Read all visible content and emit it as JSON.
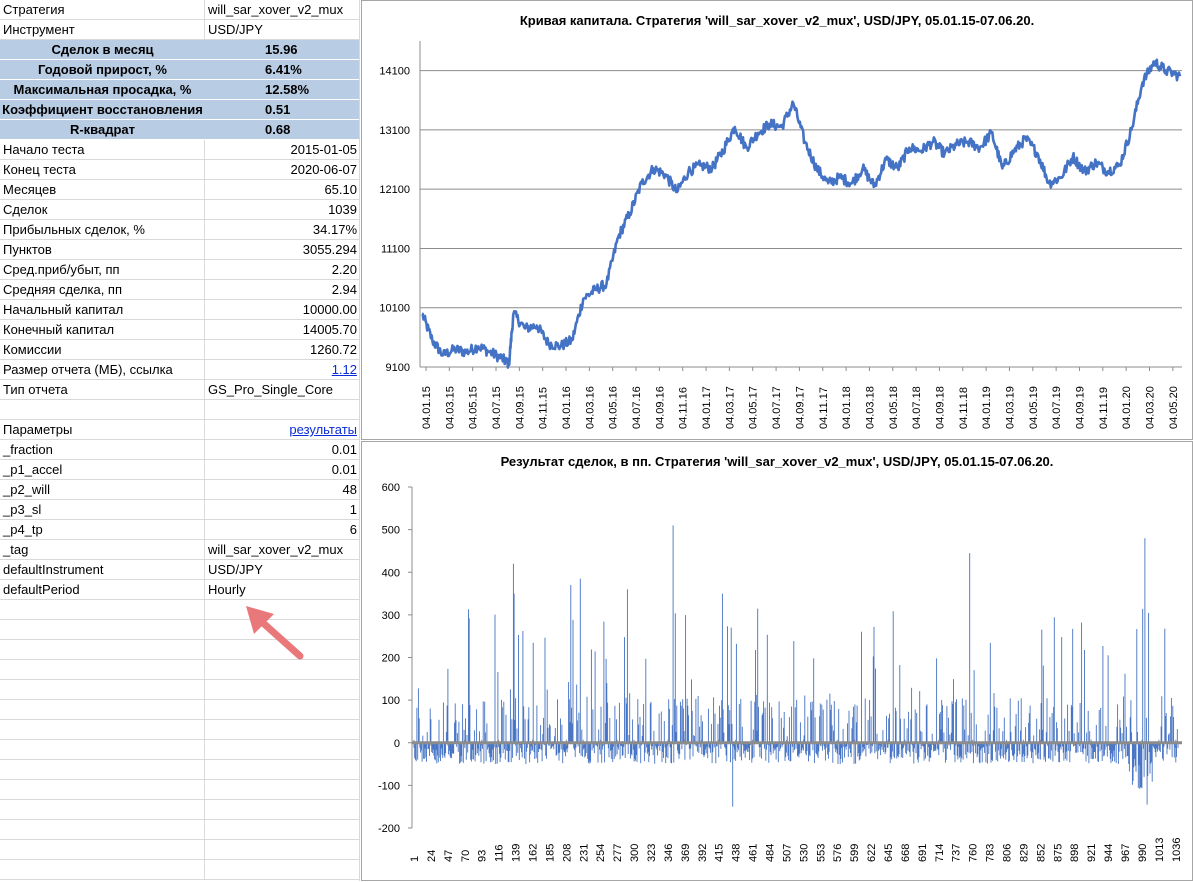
{
  "sheet": {
    "rows": [
      {
        "label": "Стратегия",
        "value": "will_sar_xover_v2_mux",
        "align": "left"
      },
      {
        "label": "Инструмент",
        "value": "USD/JPY",
        "align": "left"
      },
      {
        "label": "Сделок в месяц",
        "value": "15.96",
        "hl": true
      },
      {
        "label": "Годовой прирост, %",
        "value": "6.41%",
        "hl": true
      },
      {
        "label": "Максимальная просадка, %",
        "value": "12.58%",
        "hl": true
      },
      {
        "label": "Коэффициент восстановления",
        "value": "0.51",
        "hl": true
      },
      {
        "label": "R-квадрат",
        "value": "0.68",
        "hl": true
      },
      {
        "label": "Начало теста",
        "value": "2015-01-05"
      },
      {
        "label": "Конец теста",
        "value": "2020-06-07"
      },
      {
        "label": "Месяцев",
        "value": "65.10"
      },
      {
        "label": "Сделок",
        "value": "1039"
      },
      {
        "label": "Прибыльных сделок, %",
        "value": "34.17%"
      },
      {
        "label": "Пунктов",
        "value": "3055.294"
      },
      {
        "label": "Сред.приб/убыт, пп",
        "value": "2.20"
      },
      {
        "label": "Средняя сделка, пп",
        "value": "2.94"
      },
      {
        "label": "Начальный капитал",
        "value": "10000.00"
      },
      {
        "label": "Конечный капитал",
        "value": "14005.70"
      },
      {
        "label": "Комиссии",
        "value": "1260.72"
      },
      {
        "label": "Размер отчета (МБ), ссылка",
        "value": "1.12",
        "link": true
      },
      {
        "label": "Тип отчета",
        "value": "GS_Pro_Single_Core",
        "align": "left"
      },
      {
        "label": "",
        "value": ""
      },
      {
        "label": "Параметры",
        "value": "результаты",
        "link": true
      },
      {
        "label": "_fraction",
        "value": "0.01"
      },
      {
        "label": "_p1_accel",
        "value": "0.01"
      },
      {
        "label": "_p2_will",
        "value": "48"
      },
      {
        "label": "_p3_sl",
        "value": "1"
      },
      {
        "label": "_p4_tp",
        "value": "6"
      },
      {
        "label": "_tag",
        "value": "will_sar_xover_v2_mux",
        "align": "left"
      },
      {
        "label": "defaultInstrument",
        "value": "USD/JPY",
        "align": "left"
      },
      {
        "label": "defaultPeriod",
        "value": "Hourly",
        "align": "left"
      }
    ],
    "empty_rows": 14
  },
  "annotation": {
    "arrow_color": "#e8787a"
  },
  "chart_data": [
    {
      "type": "line",
      "title": "Кривая капитала. Стратегия 'will_sar_xover_v2_mux', USD/JPY, 05.01.15-07.06.20.",
      "xlabel": "",
      "ylabel": "",
      "ylim": [
        9100,
        14600
      ],
      "yticks": [
        9100,
        10100,
        11100,
        12100,
        13100,
        14100
      ],
      "x_tick_labels": [
        "04.01.15",
        "04.03.15",
        "04.05.15",
        "04.07.15",
        "04.09.15",
        "04.11.15",
        "04.01.16",
        "04.03.16",
        "04.05.16",
        "04.07.16",
        "04.09.16",
        "04.11.16",
        "04.01.17",
        "04.03.17",
        "04.05.17",
        "04.07.17",
        "04.09.17",
        "04.11.17",
        "04.01.18",
        "04.03.18",
        "04.05.18",
        "04.07.18",
        "04.09.18",
        "04.11.18",
        "04.01.19",
        "04.03.19",
        "04.05.19",
        "04.07.19",
        "04.09.19",
        "04.11.19",
        "04.01.20",
        "04.03.20",
        "04.05.20"
      ],
      "line_color": "#4472c4",
      "series": [
        {
          "x": [
            "2015-01-05",
            "2015-02-01",
            "2015-03-01",
            "2015-04-01",
            "2015-05-01",
            "2015-06-01",
            "2015-07-01",
            "2015-08-01",
            "2015-08-20",
            "2015-09-01",
            "2015-10-01",
            "2015-11-01",
            "2015-12-01",
            "2016-01-01",
            "2016-02-01",
            "2016-03-01",
            "2016-04-01",
            "2016-05-01",
            "2016-06-01",
            "2016-07-01",
            "2016-08-01",
            "2016-09-01",
            "2016-10-01",
            "2016-11-01",
            "2016-12-01",
            "2017-01-01",
            "2017-02-01",
            "2017-03-01",
            "2017-04-01",
            "2017-05-01",
            "2017-06-01",
            "2017-07-01",
            "2017-08-01",
            "2017-09-01",
            "2017-10-01",
            "2017-11-01",
            "2017-12-01",
            "2018-01-01",
            "2018-02-01",
            "2018-03-01",
            "2018-04-01",
            "2018-05-01",
            "2018-06-01",
            "2018-07-01",
            "2018-08-01",
            "2018-09-01",
            "2018-10-01",
            "2018-11-01",
            "2018-12-01",
            "2019-01-01",
            "2019-02-01",
            "2019-03-01",
            "2019-04-01",
            "2019-05-01",
            "2019-06-01",
            "2019-07-01",
            "2019-08-01",
            "2019-09-01",
            "2019-10-01",
            "2019-11-01",
            "2019-12-01",
            "2020-01-01",
            "2020-02-01",
            "2020-03-01",
            "2020-04-01",
            "2020-05-01",
            "2020-06-07"
          ],
          "y": [
            10000,
            9550,
            9300,
            9400,
            9350,
            9450,
            9350,
            9250,
            9150,
            10000,
            9750,
            9800,
            9500,
            9450,
            9550,
            10250,
            10400,
            10500,
            11300,
            11700,
            12200,
            12450,
            12350,
            12050,
            12400,
            12500,
            12450,
            12750,
            13150,
            12800,
            13050,
            13200,
            13150,
            13550,
            12900,
            12450,
            12200,
            12300,
            12200,
            12450,
            12150,
            12600,
            12450,
            12800,
            12750,
            12900,
            12700,
            12850,
            12900,
            12800,
            13050,
            12450,
            12750,
            12950,
            12700,
            12200,
            12300,
            12650,
            12400,
            12550,
            12400,
            12500,
            13100,
            13900,
            14250,
            14100,
            14005.7
          ]
        }
      ]
    },
    {
      "type": "bar",
      "title": "Результат сделок, в пп. Стратегия 'will_sar_xover_v2_mux', USD/JPY, 05.01.15-07.06.20.",
      "xlabel": "",
      "ylabel": "",
      "ylim": [
        -200,
        600
      ],
      "yticks": [
        -200,
        -100,
        0,
        100,
        200,
        300,
        400,
        500,
        600
      ],
      "x_tick_labels": [
        "1",
        "24",
        "47",
        "70",
        "93",
        "116",
        "139",
        "162",
        "185",
        "208",
        "231",
        "254",
        "277",
        "300",
        "323",
        "346",
        "369",
        "392",
        "415",
        "438",
        "461",
        "484",
        "507",
        "530",
        "553",
        "576",
        "599",
        "622",
        "645",
        "668",
        "691",
        "714",
        "737",
        "760",
        "783",
        "806",
        "829",
        "852",
        "875",
        "898",
        "921",
        "944",
        "967",
        "990",
        "1013",
        "1036"
      ],
      "trade_count": 1039,
      "bar_color": "#4472c4",
      "notable_values": [
        {
          "trade": 136,
          "value": 420
        },
        {
          "trade": 137,
          "value": 350
        },
        {
          "trade": 214,
          "value": 370
        },
        {
          "trade": 227,
          "value": 385
        },
        {
          "trade": 291,
          "value": 360
        },
        {
          "trade": 353,
          "value": 510
        },
        {
          "trade": 420,
          "value": 350
        },
        {
          "trade": 434,
          "value": -150
        },
        {
          "trade": 756,
          "value": 445
        },
        {
          "trade": 994,
          "value": 480
        },
        {
          "trade": 997,
          "value": -145
        }
      ]
    }
  ]
}
